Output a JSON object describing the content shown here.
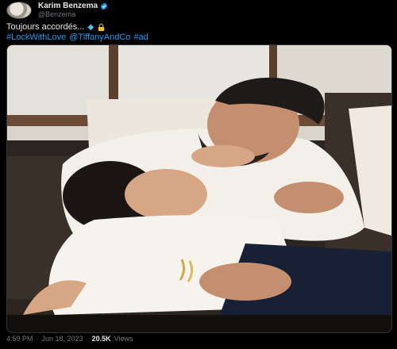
{
  "author": {
    "name": "Karim Benzema",
    "handle": "@Benzema"
  },
  "tweet": {
    "text": "Toujours accordés...",
    "hashtags": [
      "#LockWithLove",
      "@TiffanyAndCo",
      "#ad"
    ]
  },
  "meta": {
    "time": "4:59 PM",
    "separator": "·",
    "date": "Jun 18, 2023",
    "views_count": "20.5K",
    "views_label": "Views"
  },
  "icons": {
    "verified": "verified-badge-icon",
    "gem": "diamond-icon",
    "lock": "lock-icon"
  },
  "colors": {
    "link": "#1d9bf0",
    "muted": "#71767b",
    "text": "#e7e9ea"
  }
}
